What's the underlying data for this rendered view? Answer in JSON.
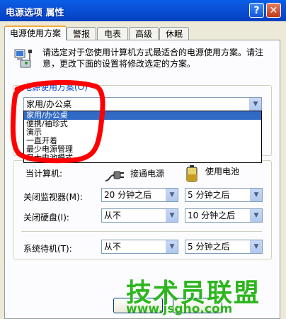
{
  "window": {
    "title": "电源选项 属性",
    "help_label": "?",
    "close_label": "✕"
  },
  "tabs": [
    "电源使用方案",
    "警报",
    "电表",
    "高级",
    "休眠"
  ],
  "intro_text": "请选定对于您使用计算机方式最适合的电源使用方案。请注意，更改下面的设置将修改选定的方案。",
  "scheme_group": {
    "legend": "电源使用方案(O)",
    "selected": "家用/办公桌",
    "options": [
      "家用/办公桌",
      "便携/袖珍式",
      "演示",
      "一直开着",
      "最少电源管理",
      "最大电池模式"
    ]
  },
  "settings_group": {
    "label": "当计算机:",
    "column_ac": "接通电源",
    "column_battery": "使用电池",
    "rows": [
      {
        "label": "关闭监视器(M):",
        "ac": "20 分钟之后",
        "battery": "5 分钟之后"
      },
      {
        "label": "关闭硬盘(I):",
        "ac": "从不",
        "battery": "10 分钟之后"
      },
      {
        "label": "系统待机(T):",
        "ac": "从不",
        "battery": "5 分钟之后"
      }
    ]
  },
  "watermark": {
    "text": "技术员联盟",
    "url": "www.jsgho.com"
  },
  "colors": {
    "accent": "#0046d5",
    "selection": "#316ac5",
    "annotation": "#ff0000",
    "watermark": "#2db61f"
  }
}
